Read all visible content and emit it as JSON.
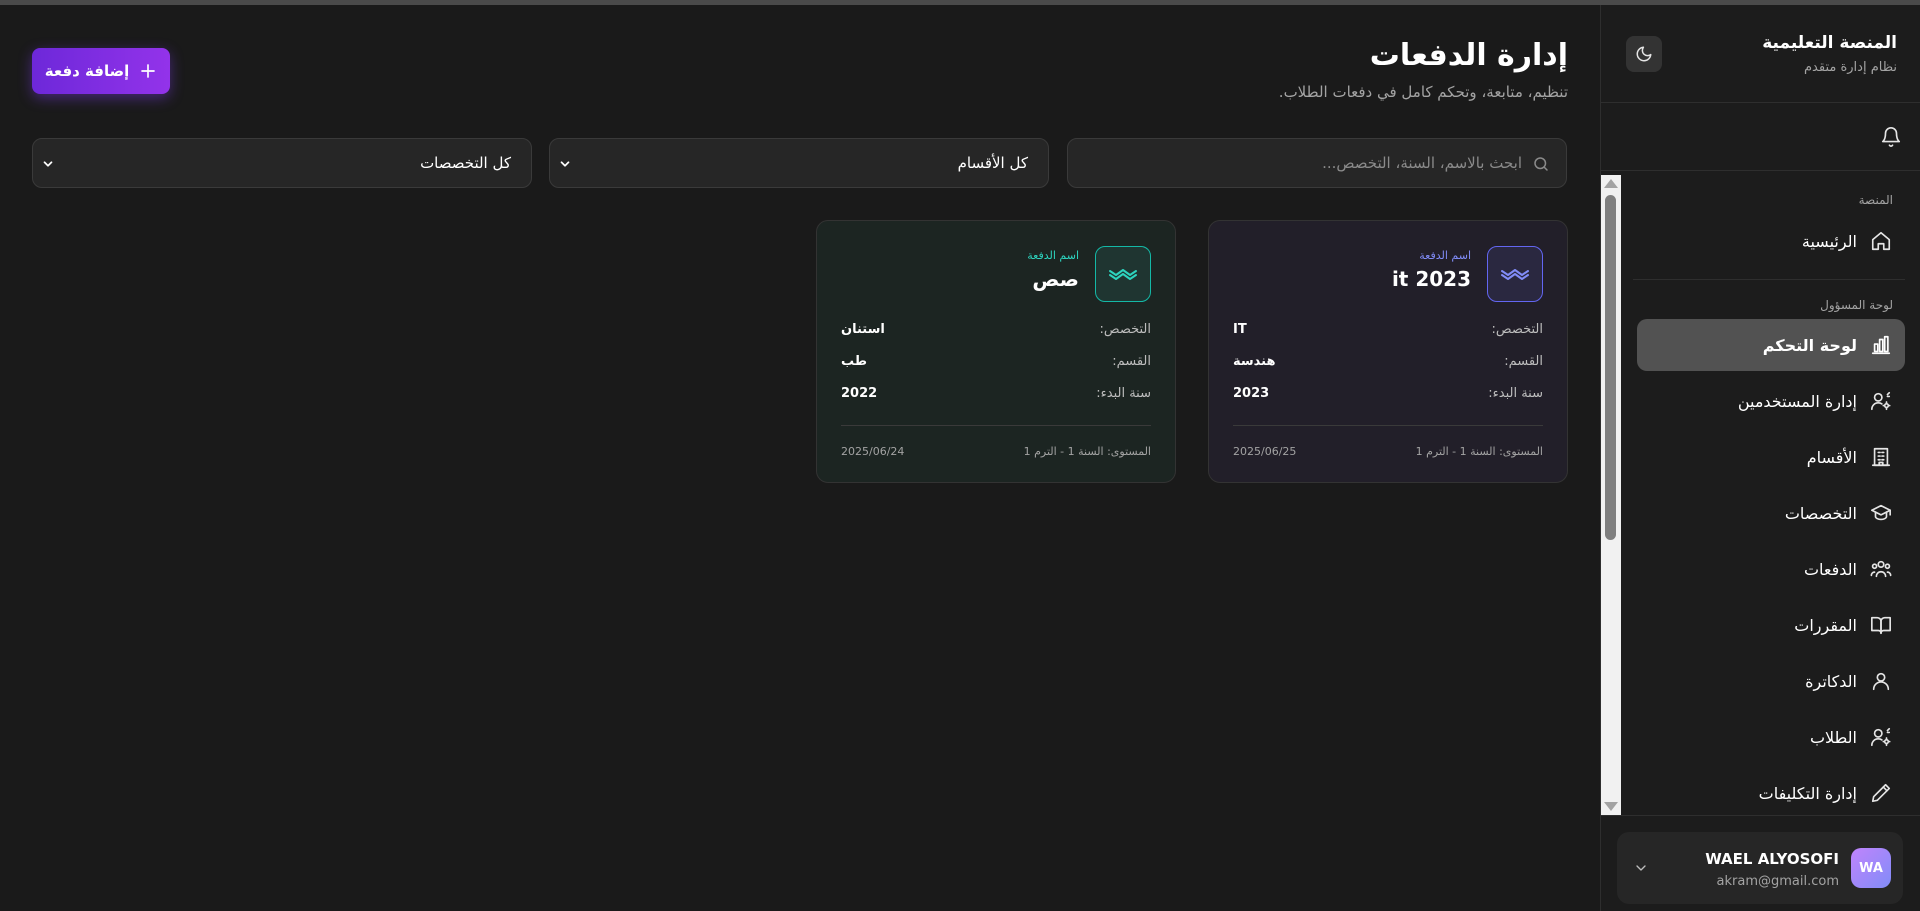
{
  "colors": {
    "accent": "#7c3aed",
    "card_purple_accent": "#818cf8",
    "card_teal_accent": "#2dd4bf",
    "background": "#1a1a1a"
  },
  "sidebar": {
    "brand_title": "المنصة التعليمية",
    "brand_subtitle": "نظام إدارة متقدم",
    "theme_icon": "moon-icon",
    "notification_icon": "bell-icon",
    "sections": {
      "platform": "المنصة",
      "admin": "لوحة المسؤول"
    },
    "items": [
      {
        "label": "الرئيسية",
        "icon": "home-icon"
      },
      {
        "label": "لوحة التحكم",
        "icon": "bar-chart-icon",
        "active": true
      },
      {
        "label": "إدارة المستخدمين",
        "icon": "users-gear-icon"
      },
      {
        "label": "الأقسام",
        "icon": "building-icon"
      },
      {
        "label": "التخصصات",
        "icon": "graduation-cap-icon"
      },
      {
        "label": "الدفعات",
        "icon": "group-icon"
      },
      {
        "label": "المقررات",
        "icon": "book-open-icon"
      },
      {
        "label": "الدكاترة",
        "icon": "user-icon"
      },
      {
        "label": "الطلاب",
        "icon": "user-gear-icon"
      },
      {
        "label": "إدارة التكليفات",
        "icon": "pencil-icon"
      }
    ],
    "user": {
      "initials": "WA",
      "name": "WAEL ALYOSOFI",
      "email": "akram@gmail.com"
    }
  },
  "header": {
    "title": "إدارة الدفعات",
    "subtitle": "تنظيم، متابعة، وتحكم كامل في دفعات الطلاب.",
    "add_button_label": "إضافة دفعة"
  },
  "filters": {
    "search_placeholder": "ابحث بالاسم، السنة، التخصص...",
    "search_value": "",
    "departments_selected": "كل الأقسام",
    "specializations_selected": "كل التخصصات"
  },
  "cards": [
    {
      "caption": "اسم الدفعة",
      "name": "it 2023",
      "specialization_label": "التخصص:",
      "specialization": "IT",
      "department_label": "القسم:",
      "department": "هندسة",
      "start_year_label": "سنة البدء:",
      "start_year": "2023",
      "level": "المستوى: السنة 1 - الترم 1",
      "date": "2025/06/25"
    },
    {
      "caption": "اسم الدفعة",
      "name": "صص",
      "specialization_label": "التخصص:",
      "specialization": "استنان",
      "department_label": "القسم:",
      "department": "طب",
      "start_year_label": "سنة البدء:",
      "start_year": "2022",
      "level": "المستوى: السنة 1 - الترم 1",
      "date": "2025/06/24"
    }
  ]
}
